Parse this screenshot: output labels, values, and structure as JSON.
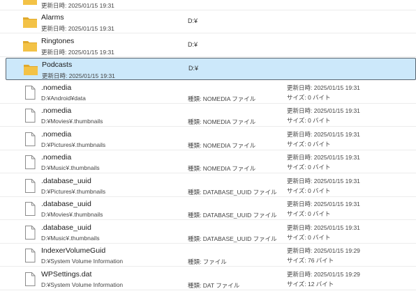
{
  "items": [
    {
      "name": "",
      "sub": "更新日時: 2025/01/15 19:31",
      "loc": "",
      "kind": "folder",
      "selected": false,
      "partial": true
    },
    {
      "name": "Alarms",
      "sub": "更新日時: 2025/01/15 19:31",
      "loc": "D:¥",
      "kind": "folder",
      "selected": false
    },
    {
      "name": "Ringtones",
      "sub": "更新日時: 2025/01/15 19:31",
      "loc": "D:¥",
      "kind": "folder",
      "selected": false
    },
    {
      "name": "Podcasts",
      "sub": "更新日時: 2025/01/15 19:31",
      "loc": "D:¥",
      "kind": "folder",
      "selected": true
    },
    {
      "name": ".nomedia",
      "sub": "D:¥Android¥data",
      "type": "種類: NOMEDIA ファイル",
      "mod": "更新日時: 2025/01/15 19:31",
      "size": "サイズ: 0 バイト",
      "kind": "file"
    },
    {
      "name": ".nomedia",
      "sub": "D:¥Movies¥.thumbnails",
      "type": "種類: NOMEDIA ファイル",
      "mod": "更新日時: 2025/01/15 19:31",
      "size": "サイズ: 0 バイト",
      "kind": "file"
    },
    {
      "name": ".nomedia",
      "sub": "D:¥Pictures¥.thumbnails",
      "type": "種類: NOMEDIA ファイル",
      "mod": "更新日時: 2025/01/15 19:31",
      "size": "サイズ: 0 バイト",
      "kind": "file"
    },
    {
      "name": ".nomedia",
      "sub": "D:¥Music¥.thumbnails",
      "type": "種類: NOMEDIA ファイル",
      "mod": "更新日時: 2025/01/15 19:31",
      "size": "サイズ: 0 バイト",
      "kind": "file"
    },
    {
      "name": ".database_uuid",
      "sub": "D:¥Pictures¥.thumbnails",
      "type": "種類: DATABASE_UUID ファイル",
      "mod": "更新日時: 2025/01/15 19:31",
      "size": "サイズ: 0 バイト",
      "kind": "file"
    },
    {
      "name": ".database_uuid",
      "sub": "D:¥Movies¥.thumbnails",
      "type": "種類: DATABASE_UUID ファイル",
      "mod": "更新日時: 2025/01/15 19:31",
      "size": "サイズ: 0 バイト",
      "kind": "file"
    },
    {
      "name": ".database_uuid",
      "sub": "D:¥Music¥.thumbnails",
      "type": "種類: DATABASE_UUID ファイル",
      "mod": "更新日時: 2025/01/15 19:31",
      "size": "サイズ: 0 バイト",
      "kind": "file"
    },
    {
      "name": "IndexerVolumeGuid",
      "sub": "D:¥System Volume Information",
      "type": "種類: ファイル",
      "mod": "更新日時: 2025/01/15 19:29",
      "size": "サイズ: 76 バイト",
      "kind": "file"
    },
    {
      "name": "WPSettings.dat",
      "sub": "D:¥System Volume Information",
      "type": "種類: DAT ファイル",
      "mod": "更新日時: 2025/01/15 19:29",
      "size": "サイズ: 12 バイト",
      "kind": "file"
    }
  ],
  "colors": {
    "selection": "#cce8fa",
    "folder": "#f3c246",
    "folder_dark": "#e0a92c"
  }
}
